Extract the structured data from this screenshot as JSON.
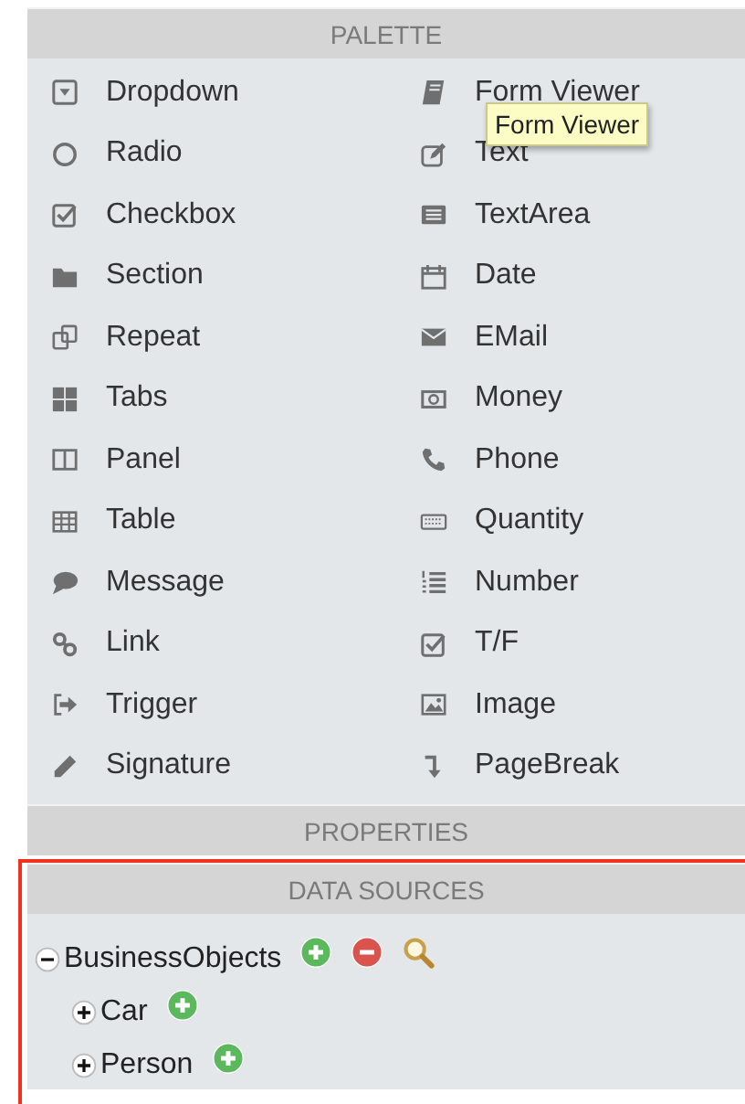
{
  "palette": {
    "title": "PALETTE",
    "columns": [
      [
        {
          "label": "Dropdown"
        },
        {
          "label": "Radio"
        },
        {
          "label": "Checkbox"
        },
        {
          "label": "Section"
        },
        {
          "label": "Repeat"
        },
        {
          "label": "Tabs"
        },
        {
          "label": "Panel"
        },
        {
          "label": "Table"
        },
        {
          "label": "Message"
        },
        {
          "label": "Link"
        },
        {
          "label": "Trigger"
        },
        {
          "label": "Signature"
        }
      ],
      [
        {
          "label": "Form Viewer",
          "tooltip": "Form Viewer"
        },
        {
          "label": "Text"
        },
        {
          "label": "TextArea"
        },
        {
          "label": "Date"
        },
        {
          "label": "EMail"
        },
        {
          "label": "Money"
        },
        {
          "label": "Phone"
        },
        {
          "label": "Quantity"
        },
        {
          "label": "Number"
        },
        {
          "label": "T/F"
        },
        {
          "label": "Image"
        },
        {
          "label": "PageBreak"
        }
      ]
    ]
  },
  "properties": {
    "title": "PROPERTIES"
  },
  "data_sources": {
    "title": "DATA SOURCES",
    "highlighted": true,
    "tree": [
      {
        "label": "BusinessObjects",
        "expanded": true,
        "actions": [
          {
            "kind": "add"
          },
          {
            "kind": "remove"
          },
          {
            "kind": "search"
          }
        ],
        "children": [
          {
            "label": "Car",
            "expanded": false,
            "actions": [
              {
                "kind": "add"
              }
            ]
          },
          {
            "label": "Person",
            "expanded": false,
            "actions": [
              {
                "kind": "add"
              }
            ]
          }
        ]
      }
    ]
  }
}
